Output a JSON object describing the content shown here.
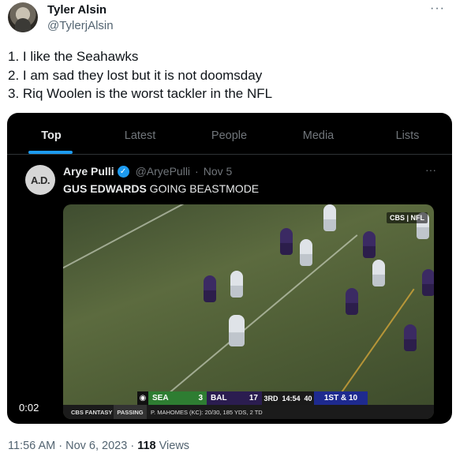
{
  "tweet": {
    "author_name": "Tyler Alsin",
    "author_handle": "@TylerjAlsin",
    "more": "···",
    "lines": [
      "1. I like the Seahawks",
      "2. I am sad they lost but it is not doomsday",
      "3. Riq Woolen is the worst tackler in the NFL"
    ]
  },
  "media": {
    "tabs": [
      "Top",
      "Latest",
      "People",
      "Media",
      "Lists"
    ],
    "inner_tweet": {
      "avatar_text": "A.D.",
      "name": "Arye Pulli",
      "handle": "@AryePulli",
      "separator": "·",
      "date": "Nov 5",
      "more": "···",
      "text_bold": "GUS EDWARDS",
      "text_rest": " GOING BEASTMODE"
    },
    "video": {
      "network_logo": "CBS | NFL",
      "home_team": "SEA",
      "home_score": "3",
      "away_team": "BAL",
      "away_score": "17",
      "quarter": "3RD",
      "clock": "14:54",
      "play_clock": "40",
      "down_distance": "1ST & 10",
      "brand": "CBS FANTASY",
      "stat_label": "PASSING",
      "stat_line": "P. MAHOMES (KC): 20/30, 185 YDS, 2 TD"
    },
    "timer": "0:02"
  },
  "footer": {
    "time": "11:56 AM",
    "date": "Nov 6, 2023",
    "views_count": "118",
    "views_label": "Views"
  }
}
